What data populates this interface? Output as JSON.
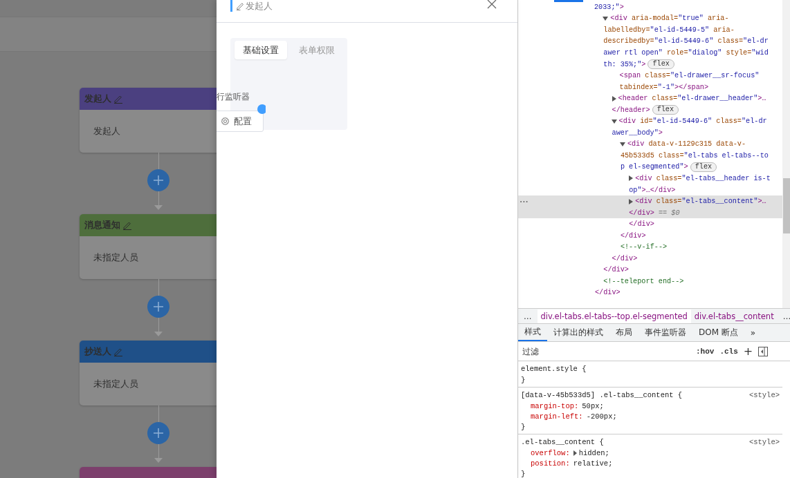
{
  "flow": {
    "nodes": [
      {
        "title": "发起人",
        "body": "发起人",
        "color": "#4b4080"
      },
      {
        "title": "消息通知",
        "body": "未指定人员",
        "color": "#4e6e3c"
      },
      {
        "title": "抄送人",
        "body": "未指定人员",
        "color": "#1f5088"
      },
      {
        "color": "#7c3f6c"
      }
    ]
  },
  "drawer": {
    "title": "发起人",
    "tabs": [
      {
        "label": "基础设置",
        "selected": true
      },
      {
        "label": "表单权限",
        "selected": false
      }
    ],
    "section_label": "行监听器",
    "config_button": "配置"
  },
  "devtools": {
    "tree": [
      {
        "kind": "tail",
        "selected": false,
        "lines": [
          [
            {
              "kind": "value",
              "text": "2033;\""
            },
            {
              "kind": "tag",
              "text": ">"
            }
          ]
        ],
        "end": [
          {
            "kind": "tag",
            "text": "</div>"
          }
        ],
        "children": [
          {
            "kind": "element",
            "expanded": true,
            "selected": false,
            "lines": [
              [
                {
                  "kind": "tag",
                  "text": "<div"
                },
                {
                  "kind": "attr",
                  "text": " aria-modal="
                },
                {
                  "kind": "value",
                  "text": "\"true\""
                },
                {
                  "kind": "attr",
                  "text": " aria-"
                }
              ],
              [
                {
                  "kind": "attr",
                  "text": "labelledby="
                },
                {
                  "kind": "value",
                  "text": "\"el-id-5449-5\""
                },
                {
                  "kind": "attr",
                  "text": " aria-"
                }
              ],
              [
                {
                  "kind": "attr",
                  "text": "describedby="
                },
                {
                  "kind": "value",
                  "text": "\"el-id-5449-6\""
                },
                {
                  "kind": "attr",
                  "text": " class="
                },
                {
                  "kind": "value",
                  "text": "\"el-dr"
                }
              ],
              [
                {
                  "kind": "value",
                  "text": "awer rtl open\""
                },
                {
                  "kind": "attr",
                  "text": " role="
                },
                {
                  "kind": "value",
                  "text": "\"dialog\""
                },
                {
                  "kind": "attr",
                  "text": " style="
                },
                {
                  "kind": "value",
                  "text": "\"wid"
                }
              ],
              [
                {
                  "kind": "value",
                  "text": "th: 35%;\""
                },
                {
                  "kind": "tag",
                  "text": ">"
                },
                {
                  "kind": "badge",
                  "text": "flex"
                }
              ]
            ],
            "end": [
              {
                "kind": "tag",
                "text": "</div>"
              }
            ],
            "children": [
              {
                "kind": "leaf",
                "selected": false,
                "lines": [
                  [
                    {
                      "kind": "tag",
                      "text": "<span"
                    },
                    {
                      "kind": "attr",
                      "text": " class="
                    },
                    {
                      "kind": "value",
                      "text": "\"el-drawer__sr-focus\""
                    }
                  ],
                  [
                    {
                      "kind": "attr",
                      "text": "tabindex="
                    },
                    {
                      "kind": "value",
                      "text": "\"-1\""
                    },
                    {
                      "kind": "tag",
                      "text": "></span>"
                    }
                  ]
                ]
              },
              {
                "kind": "element",
                "expanded": false,
                "selected": false,
                "lines": [
                  [
                    {
                      "kind": "tag",
                      "text": "<header"
                    },
                    {
                      "kind": "attr",
                      "text": " class="
                    },
                    {
                      "kind": "value",
                      "text": "\"el-drawer__header\""
                    },
                    {
                      "kind": "tag",
                      "text": ">…"
                    }
                  ],
                  [
                    {
                      "kind": "tag",
                      "text": "</header>"
                    },
                    {
                      "kind": "badge",
                      "text": "flex"
                    }
                  ]
                ]
              },
              {
                "kind": "element",
                "expanded": true,
                "selected": false,
                "lines": [
                  [
                    {
                      "kind": "tag",
                      "text": "<div"
                    },
                    {
                      "kind": "attr",
                      "text": " id="
                    },
                    {
                      "kind": "value",
                      "text": "\"el-id-5449-6\""
                    },
                    {
                      "kind": "attr",
                      "text": " class="
                    },
                    {
                      "kind": "value",
                      "text": "\"el-dr"
                    }
                  ],
                  [
                    {
                      "kind": "value",
                      "text": "awer__body\""
                    },
                    {
                      "kind": "tag",
                      "text": ">"
                    }
                  ]
                ],
                "end": [
                  {
                    "kind": "tag",
                    "text": "</div>"
                  }
                ],
                "children": [
                  {
                    "kind": "element",
                    "expanded": true,
                    "selected": false,
                    "lines": [
                      [
                        {
                          "kind": "tag",
                          "text": "<div"
                        },
                        {
                          "kind": "attr",
                          "text": " data-v-1129c315 data-v-"
                        }
                      ],
                      [
                        {
                          "kind": "attr",
                          "text": "45b533d5 class="
                        },
                        {
                          "kind": "value",
                          "text": "\"el-tabs el-tabs--to"
                        }
                      ],
                      [
                        {
                          "kind": "value",
                          "text": "p el-segmented\""
                        },
                        {
                          "kind": "tag",
                          "text": ">"
                        },
                        {
                          "kind": "badge",
                          "text": "flex"
                        }
                      ]
                    ],
                    "end": [
                      {
                        "kind": "tag",
                        "text": "</div>"
                      }
                    ],
                    "children": [
                      {
                        "kind": "element",
                        "expanded": false,
                        "selected": false,
                        "lines": [
                          [
                            {
                              "kind": "tag",
                              "text": "<div"
                            },
                            {
                              "kind": "attr",
                              "text": " class="
                            },
                            {
                              "kind": "value",
                              "text": "\"el-tabs__header is-t"
                            }
                          ],
                          [
                            {
                              "kind": "value",
                              "text": "op\""
                            },
                            {
                              "kind": "tag",
                              "text": ">…</div>"
                            }
                          ]
                        ]
                      },
                      {
                        "kind": "element",
                        "expanded": false,
                        "selected": true,
                        "gutter": "•••",
                        "lines": [
                          [
                            {
                              "kind": "tag",
                              "text": "<div"
                            },
                            {
                              "kind": "attr",
                              "text": " class="
                            },
                            {
                              "kind": "value",
                              "text": "\"el-tabs__content\""
                            },
                            {
                              "kind": "tag",
                              "text": ">…"
                            }
                          ],
                          [
                            {
                              "kind": "tag",
                              "text": "</div>"
                            },
                            {
                              "kind": "marker",
                              "text": " == $0"
                            }
                          ]
                        ]
                      },
                      {
                        "kind": "text",
                        "selected": false,
                        "lines": [
                          [
                            {
                              "kind": "tag",
                              "text": "</div>"
                            }
                          ]
                        ]
                      }
                    ]
                  },
                  {
                    "kind": "text",
                    "selected": false,
                    "lines": [
                      [
                        {
                          "kind": "comment",
                          "text": "<!--v-if-->"
                        }
                      ]
                    ]
                  }
                ]
              }
            ]
          },
          {
            "kind": "text",
            "selected": false,
            "lines": [
              [
                {
                  "kind": "comment",
                  "text": "<!--teleport end-->"
                }
              ]
            ]
          }
        ]
      }
    ],
    "breadcrumbs": {
      "prev": "…",
      "items": [
        {
          "label": "div.el-tabs.el-tabs--top.el-segmented",
          "selected": false
        },
        {
          "label": "div.el-tabs__content",
          "selected": true
        }
      ],
      "next": "…"
    },
    "tabs": [
      {
        "label": "样式",
        "selected": true
      },
      {
        "label": "计算出的样式",
        "selected": false
      },
      {
        "label": "布局",
        "selected": false
      },
      {
        "label": "事件监听器",
        "selected": false
      },
      {
        "label": "DOM 断点",
        "selected": false
      }
    ],
    "more_tabs": "»",
    "filter": {
      "placeholder": "过滤",
      "hov": ":hov",
      "cls": ".cls",
      "add": "+"
    },
    "rules": [
      {
        "selector": "element.style {",
        "close": "}"
      },
      {
        "selector": "[data-v-45b533d5] .el-tabs__content {",
        "source": "<style>",
        "close": "}",
        "props": [
          {
            "name": "margin-top:",
            "value": "50px;"
          },
          {
            "name": "margin-left:",
            "value": "-200px;"
          }
        ]
      },
      {
        "selector": ".el-tabs__content {",
        "source": "<style>",
        "close": "}",
        "props": [
          {
            "name": "overflow:",
            "value": "hidden;",
            "expandable": true
          },
          {
            "name": "position:",
            "value": "relative;"
          }
        ]
      }
    ]
  }
}
